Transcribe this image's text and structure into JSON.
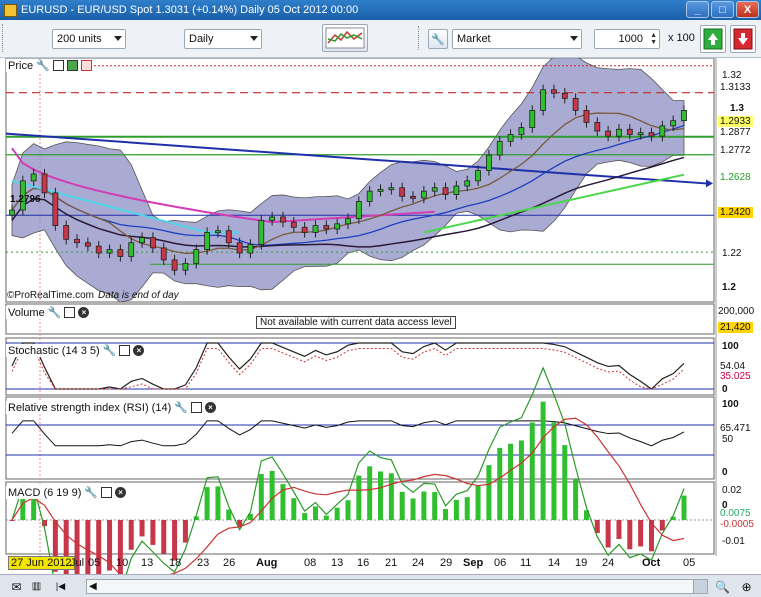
{
  "window": {
    "title": "EURUSD - EUR/USD Spot    1.3031 (+0.14%)    Daily  05 Oct 2012 00:00",
    "minimize": "_",
    "maximize": "□",
    "close": "X"
  },
  "toolbar": {
    "units_select": "200 units",
    "period_select": "Daily",
    "order_type_select": "Market",
    "quantity": "1000",
    "multiplier": "x 100"
  },
  "price_panel": {
    "label": "Price",
    "watermark": "©ProRealTime.com",
    "data_note": "Data is end of day",
    "axis_ticks": [
      "1.32",
      "1.3",
      "1.22",
      "1.2"
    ],
    "price_tags": [
      {
        "value": "1.3133",
        "color": "#ffffff"
      },
      {
        "value": "1.2933",
        "color": "#ffff66"
      },
      {
        "value": "1.2877",
        "color": "#ffffff"
      },
      {
        "value": "1.2772",
        "color": "#ffffff"
      },
      {
        "value": "1.2628",
        "color": "#ffffff"
      },
      {
        "value": "1.2420",
        "color": "#ffd400"
      }
    ],
    "left_value": "1.2796"
  },
  "volume_panel": {
    "label": "Volume",
    "notice": "Not available with current data access level",
    "axis_tick": "200,000",
    "value_tag": "21,420"
  },
  "stochastic_panel": {
    "label": "Stochastic (14 3 5)",
    "axis_ticks": [
      "100",
      "0"
    ],
    "value_tags": [
      "54.04",
      "35.025"
    ]
  },
  "rsi_panel": {
    "label": "Relative strength index (RSI) (14)",
    "axis_ticks": [
      "100",
      "50",
      "0"
    ],
    "value_tag": "65.471"
  },
  "macd_panel": {
    "label": "MACD (6 19 9)",
    "axis_ticks": [
      "0.02",
      "0",
      "-0.01"
    ],
    "value_tags": [
      "0.0075",
      "-0.0005"
    ]
  },
  "date_axis": {
    "highlight": "27 Jun 2012",
    "labels": [
      "Jul",
      "05",
      "10",
      "13",
      "18",
      "23",
      "26",
      "Aug",
      "08",
      "13",
      "16",
      "21",
      "24",
      "29",
      "Sep",
      "06",
      "11",
      "14",
      "19",
      "24",
      "Oct",
      "05"
    ]
  },
  "chart_data": {
    "type": "candlestick",
    "x": [
      "27 Jun 2012",
      "05 Oct 2012"
    ],
    "x_ticks": [
      "Jul",
      "05",
      "10",
      "13",
      "18",
      "23",
      "26",
      "Aug",
      "08",
      "13",
      "16",
      "21",
      "24",
      "29",
      "Sep",
      "06",
      "11",
      "14",
      "19",
      "24",
      "Oct",
      "05"
    ],
    "y_ticks": [
      1.32,
      1.3,
      1.22,
      1.2
    ],
    "ylim": [
      1.195,
      1.33
    ],
    "close_series": [
      1.245,
      1.262,
      1.266,
      1.255,
      1.236,
      1.228,
      1.226,
      1.224,
      1.22,
      1.222,
      1.218,
      1.226,
      1.229,
      1.223,
      1.216,
      1.21,
      1.214,
      1.222,
      1.232,
      1.233,
      1.226,
      1.22,
      1.225,
      1.239,
      1.241,
      1.238,
      1.235,
      1.232,
      1.236,
      1.234,
      1.237,
      1.24,
      1.25,
      1.256,
      1.257,
      1.258,
      1.253,
      1.252,
      1.256,
      1.258,
      1.254,
      1.259,
      1.262,
      1.268,
      1.277,
      1.285,
      1.289,
      1.293,
      1.303,
      1.315,
      1.313,
      1.31,
      1.303,
      1.296,
      1.291,
      1.288,
      1.292,
      1.289,
      1.29,
      1.288,
      1.294,
      1.297,
      1.303
    ]
  },
  "colors": {
    "candle_up": "#2fbf2f",
    "candle_down": "#c8364a",
    "bollinger_fill": "#8d8fc4",
    "ma_blue": "#1f3fbf",
    "ma_magenta": "#d23cb4",
    "ma_cyan": "#4fd6ea",
    "ma_green": "#4bd64b",
    "ma_brown": "#7a5a3a",
    "support_line": "#2e9e2e",
    "resistance_dashed": "#c62828",
    "trend_line": "#1f2fa8"
  }
}
